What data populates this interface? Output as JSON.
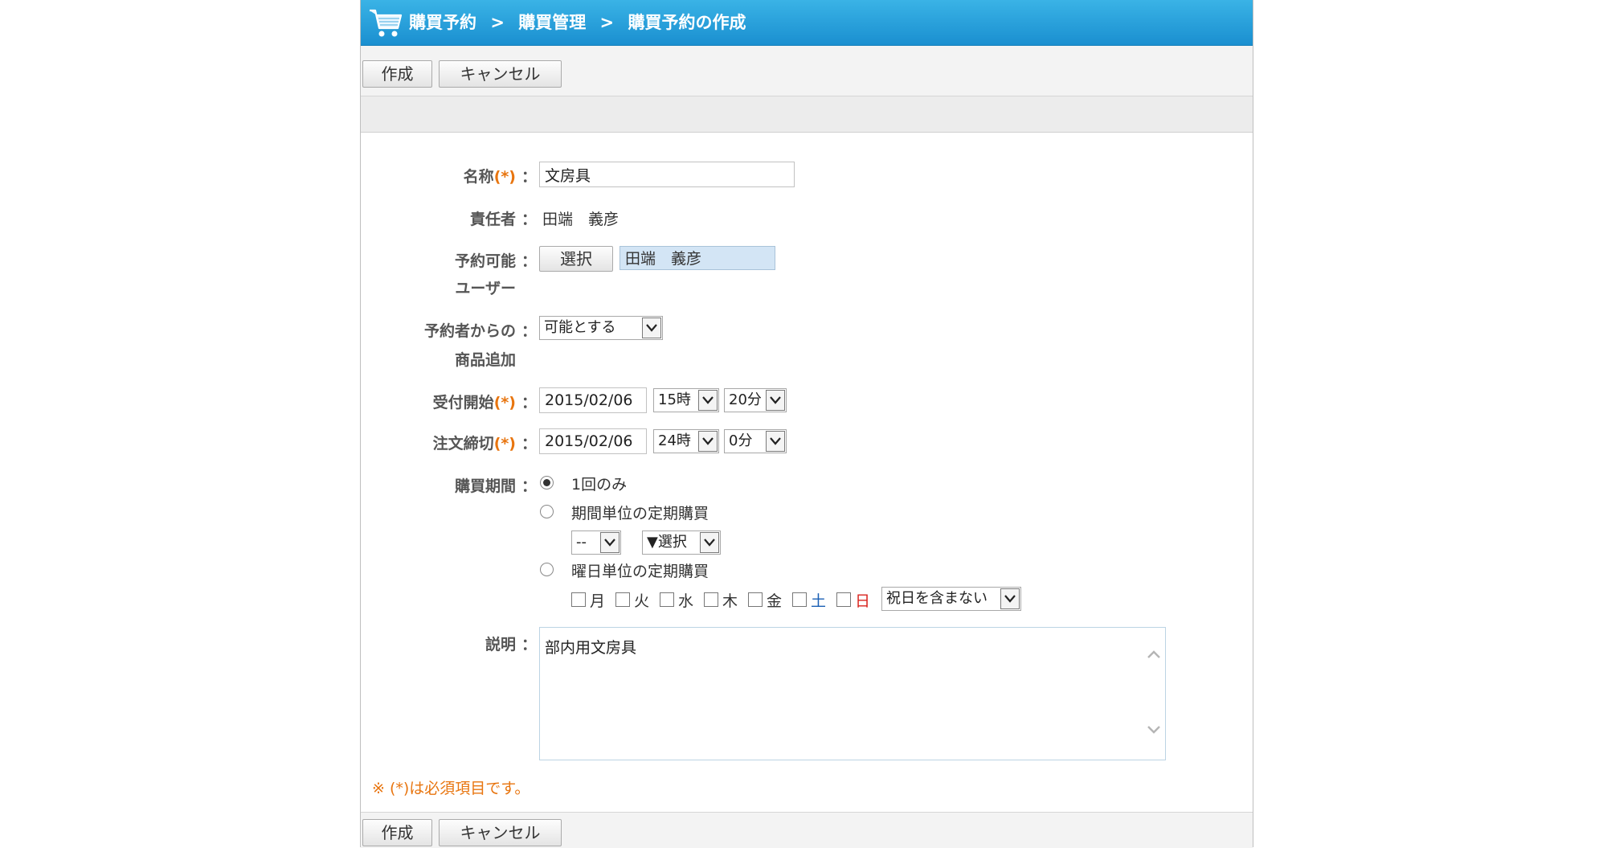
{
  "header": {
    "breadcrumb": [
      "購買予約",
      ">",
      "購買管理",
      ">",
      "購買予約の作成"
    ]
  },
  "toolbar": {
    "create_label": "作成",
    "cancel_label": "キャンセル"
  },
  "form": {
    "name": {
      "label": "名称",
      "req": "(*)",
      "value": "文房具"
    },
    "owner": {
      "label": "責任者",
      "value": "田端　義彦"
    },
    "users": {
      "label_line1": "予約可能",
      "label_line2": "ユーザー",
      "select_button": "選択",
      "selected": "田端　義彦"
    },
    "add_item": {
      "label_line1": "予約者からの",
      "label_line2": "商品追加",
      "selected": "可能とする"
    },
    "start": {
      "label": "受付開始",
      "req": "(*)",
      "date": "2015/02/06",
      "hour": "15時",
      "minute": "20分"
    },
    "deadline": {
      "label": "注文締切",
      "req": "(*)",
      "date": "2015/02/06",
      "hour": "24時",
      "minute": "0分"
    },
    "period": {
      "label": "購買期間",
      "once": "1回のみ",
      "regular": "期間単位の定期購買",
      "regular_unit": "--",
      "regular_select": "▼選択",
      "weekday": "曜日単位の定期購買",
      "days": [
        "月",
        "火",
        "水",
        "木",
        "金",
        "土",
        "日"
      ],
      "holiday": "祝日を含まない",
      "selected_option": "1回のみ"
    },
    "description": {
      "label": "説明",
      "value": "部内用文房具"
    },
    "colon": "："
  },
  "note": "※ (*)は必須項目です。",
  "colors": {
    "header_top": "#3ab3e6",
    "header_bottom": "#1a8fd0",
    "required": "#e8750f",
    "sunday": "#d9231d",
    "saturday": "#1a5fb4",
    "selected_user_bg": "#d3e5f5"
  }
}
